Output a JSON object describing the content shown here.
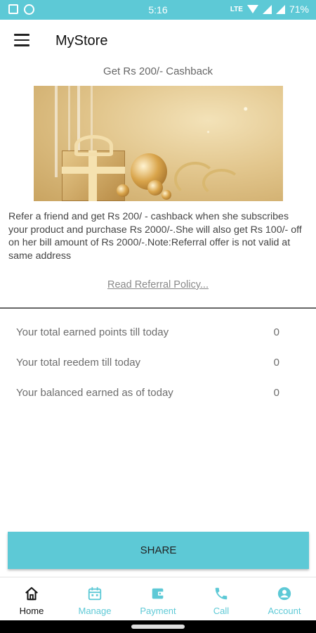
{
  "status_bar": {
    "time": "5:16",
    "battery": "71%",
    "network_label": "LTE"
  },
  "app_bar": {
    "title": "MyStore"
  },
  "offer": {
    "title": "Get Rs 200/- Cashback",
    "description": "Refer a friend and get Rs 200/ - cashback when she subscribes your product  and purchase Rs 2000/-.She will also get Rs 100/- off on her bill  amount of Rs 2000/-.Note:Referral offer is not valid at same address",
    "policy_link": "Read Referral Policy..."
  },
  "stats": [
    {
      "label": "Your total earned points till today",
      "value": "0"
    },
    {
      "label": "Your total reedem till today",
      "value": "0"
    },
    {
      "label": "Your balanced earned as of today",
      "value": "0"
    }
  ],
  "share_button": "SHARE",
  "bottom_nav": [
    {
      "label": "Home",
      "icon": "home-icon",
      "active": true
    },
    {
      "label": "Manage",
      "icon": "calendar-icon",
      "active": false
    },
    {
      "label": "Payment",
      "icon": "wallet-icon",
      "active": false
    },
    {
      "label": "Call",
      "icon": "phone-icon",
      "active": false
    },
    {
      "label": "Account",
      "icon": "account-icon",
      "active": false
    }
  ],
  "colors": {
    "accent": "#5dc9d6",
    "active_nav": "#111111",
    "text_muted": "#6d6d6d"
  }
}
